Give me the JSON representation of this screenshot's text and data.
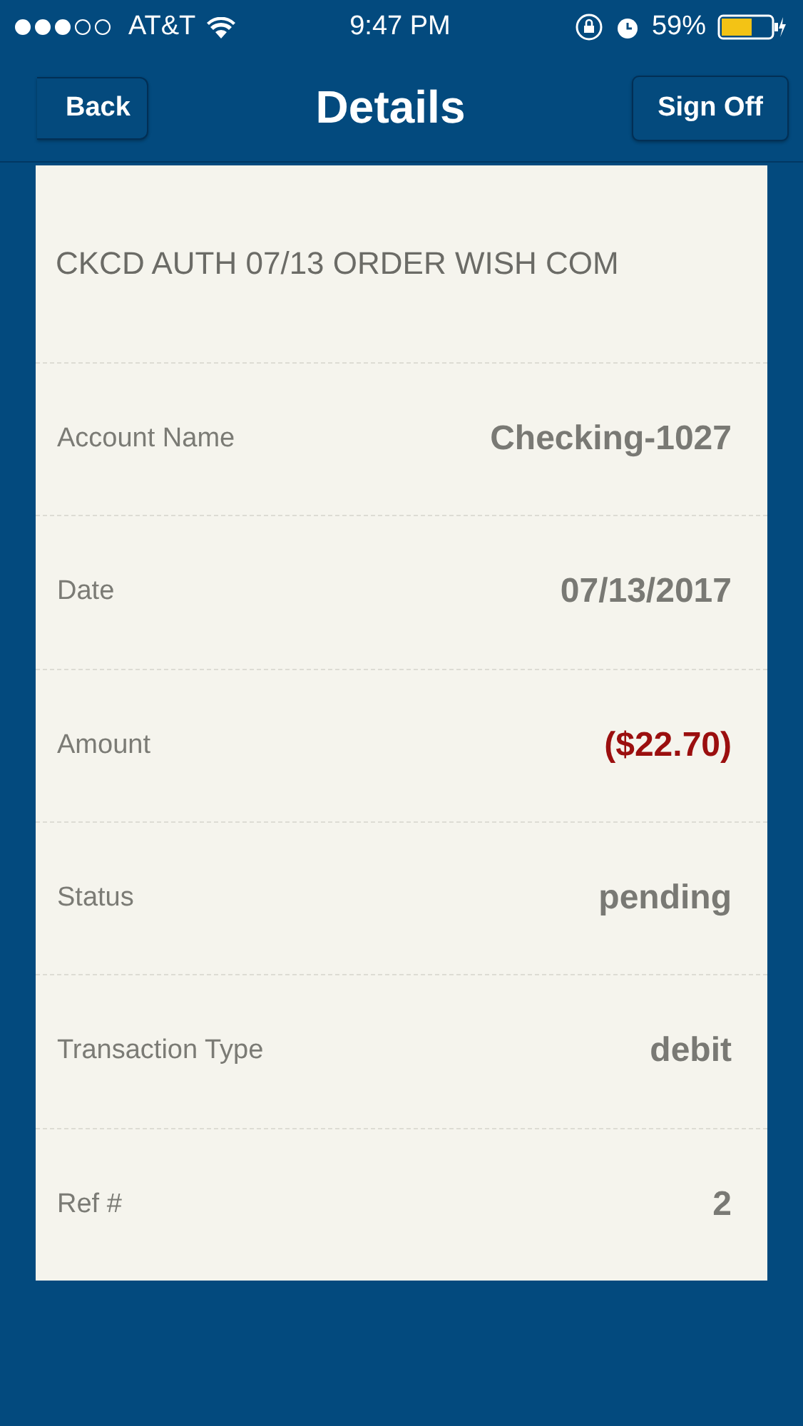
{
  "status_bar": {
    "carrier": "AT&T",
    "time": "9:47 PM",
    "battery": "59%"
  },
  "nav": {
    "back": "Back",
    "title": "Details",
    "action": "Sign Off"
  },
  "details": {
    "description": "CKCD AUTH 07/13 ORDER WISH COM",
    "rows": [
      {
        "label": "Account Name",
        "value": "Checking-1027",
        "kind": "plain"
      },
      {
        "label": "Date",
        "value": "07/13/2017",
        "kind": "plain"
      },
      {
        "label": "Amount",
        "value": "($22.70)",
        "kind": "negative"
      },
      {
        "label": "Status",
        "value": "pending",
        "kind": "plain"
      },
      {
        "label": "Transaction Type",
        "value": "debit",
        "kind": "plain"
      },
      {
        "label": "Ref #",
        "value": "2",
        "kind": "plain"
      }
    ]
  }
}
